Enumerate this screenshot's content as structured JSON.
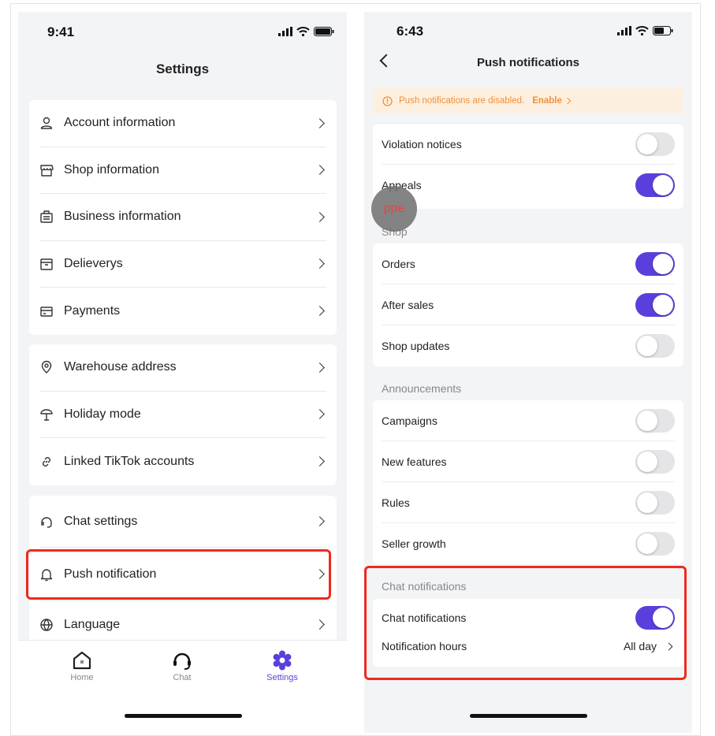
{
  "left": {
    "status_time": "9:41",
    "title": "Settings",
    "groups": [
      [
        {
          "label": "Account information",
          "icon": "user-icon"
        },
        {
          "label": "Shop information",
          "icon": "shop-icon"
        },
        {
          "label": "Business information",
          "icon": "briefcase-icon"
        },
        {
          "label": "Delieverys",
          "icon": "box-icon"
        },
        {
          "label": "Payments",
          "icon": "credit-card-icon"
        }
      ],
      [
        {
          "label": "Warehouse address",
          "icon": "location-pin-icon"
        },
        {
          "label": "Holiday mode",
          "icon": "umbrella-icon"
        },
        {
          "label": "Linked TikTok accounts",
          "icon": "link-icon"
        }
      ],
      [
        {
          "label": "Chat settings",
          "icon": "headset-icon"
        },
        {
          "label": "Push notification",
          "icon": "bell-icon"
        },
        {
          "label": "Language",
          "icon": "globe-icon"
        }
      ]
    ],
    "nav": [
      {
        "label": "Home",
        "icon": "home-icon"
      },
      {
        "label": "Chat",
        "icon": "headset-icon"
      },
      {
        "label": "Settings",
        "icon": "gear-icon",
        "active": true
      }
    ],
    "accent": "#5b3fdc"
  },
  "right": {
    "status_time": "6:43",
    "title": "Push notifications",
    "banner": {
      "text": "Push notifications are disabled.",
      "action": "Enable",
      "color": "#f0903a",
      "bg": "#fdefdf"
    },
    "overlay_text": "ppe",
    "group0": [
      {
        "label": "Violation notices",
        "on": false
      },
      {
        "label": "Appeals",
        "on": true
      }
    ],
    "shop": {
      "header": "Shop",
      "items": [
        {
          "label": "Orders",
          "on": true
        },
        {
          "label": "After sales",
          "on": true
        },
        {
          "label": "Shop updates",
          "on": false
        }
      ]
    },
    "announcements": {
      "header": "Announcements",
      "items": [
        {
          "label": "Campaigns",
          "on": false
        },
        {
          "label": "New features",
          "on": false
        },
        {
          "label": "Rules",
          "on": false
        },
        {
          "label": "Seller growth",
          "on": false
        }
      ]
    },
    "chat": {
      "header": "Chat notifications",
      "toggle_label": "Chat notifications",
      "toggle_on": true,
      "hours_label": "Notification hours",
      "hours_value": "All day"
    }
  }
}
